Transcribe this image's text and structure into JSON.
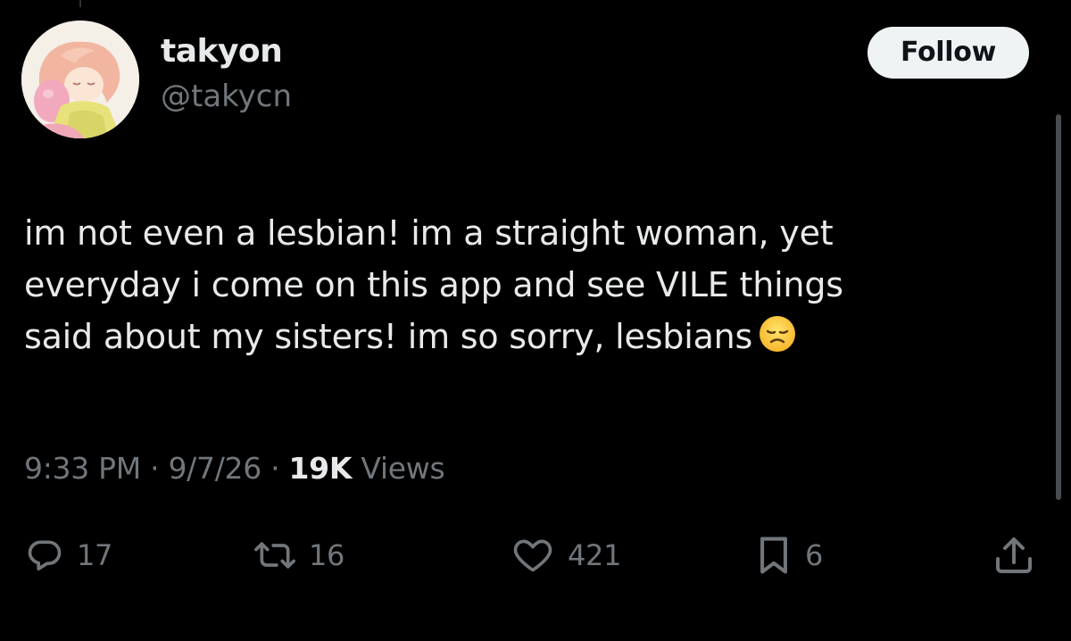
{
  "author": {
    "display_name": "takyon",
    "handle": "@takycn",
    "avatar_icon": "anime-character-avatar"
  },
  "follow_button": {
    "label": "Follow"
  },
  "tweet": {
    "lines": [
      "im not even a lesbian! im a straight woman, yet",
      "everyday i come on this app and see VILE things",
      "said about my sisters! im so sorry, lesbians"
    ],
    "emoji": "disappointed-face-emoji"
  },
  "meta": {
    "time": "9:33 PM",
    "separator": "·",
    "date": "9/7/26",
    "views_count": "19K",
    "views_label": "Views"
  },
  "actions": {
    "replies": "17",
    "reposts": "16",
    "likes": "421",
    "bookmarks": "6"
  },
  "colors": {
    "background": "#000000",
    "text_primary": "#e7e9ea",
    "text_secondary": "#71767b",
    "follow_bg": "#eff3f4",
    "follow_text": "#0f1419"
  }
}
